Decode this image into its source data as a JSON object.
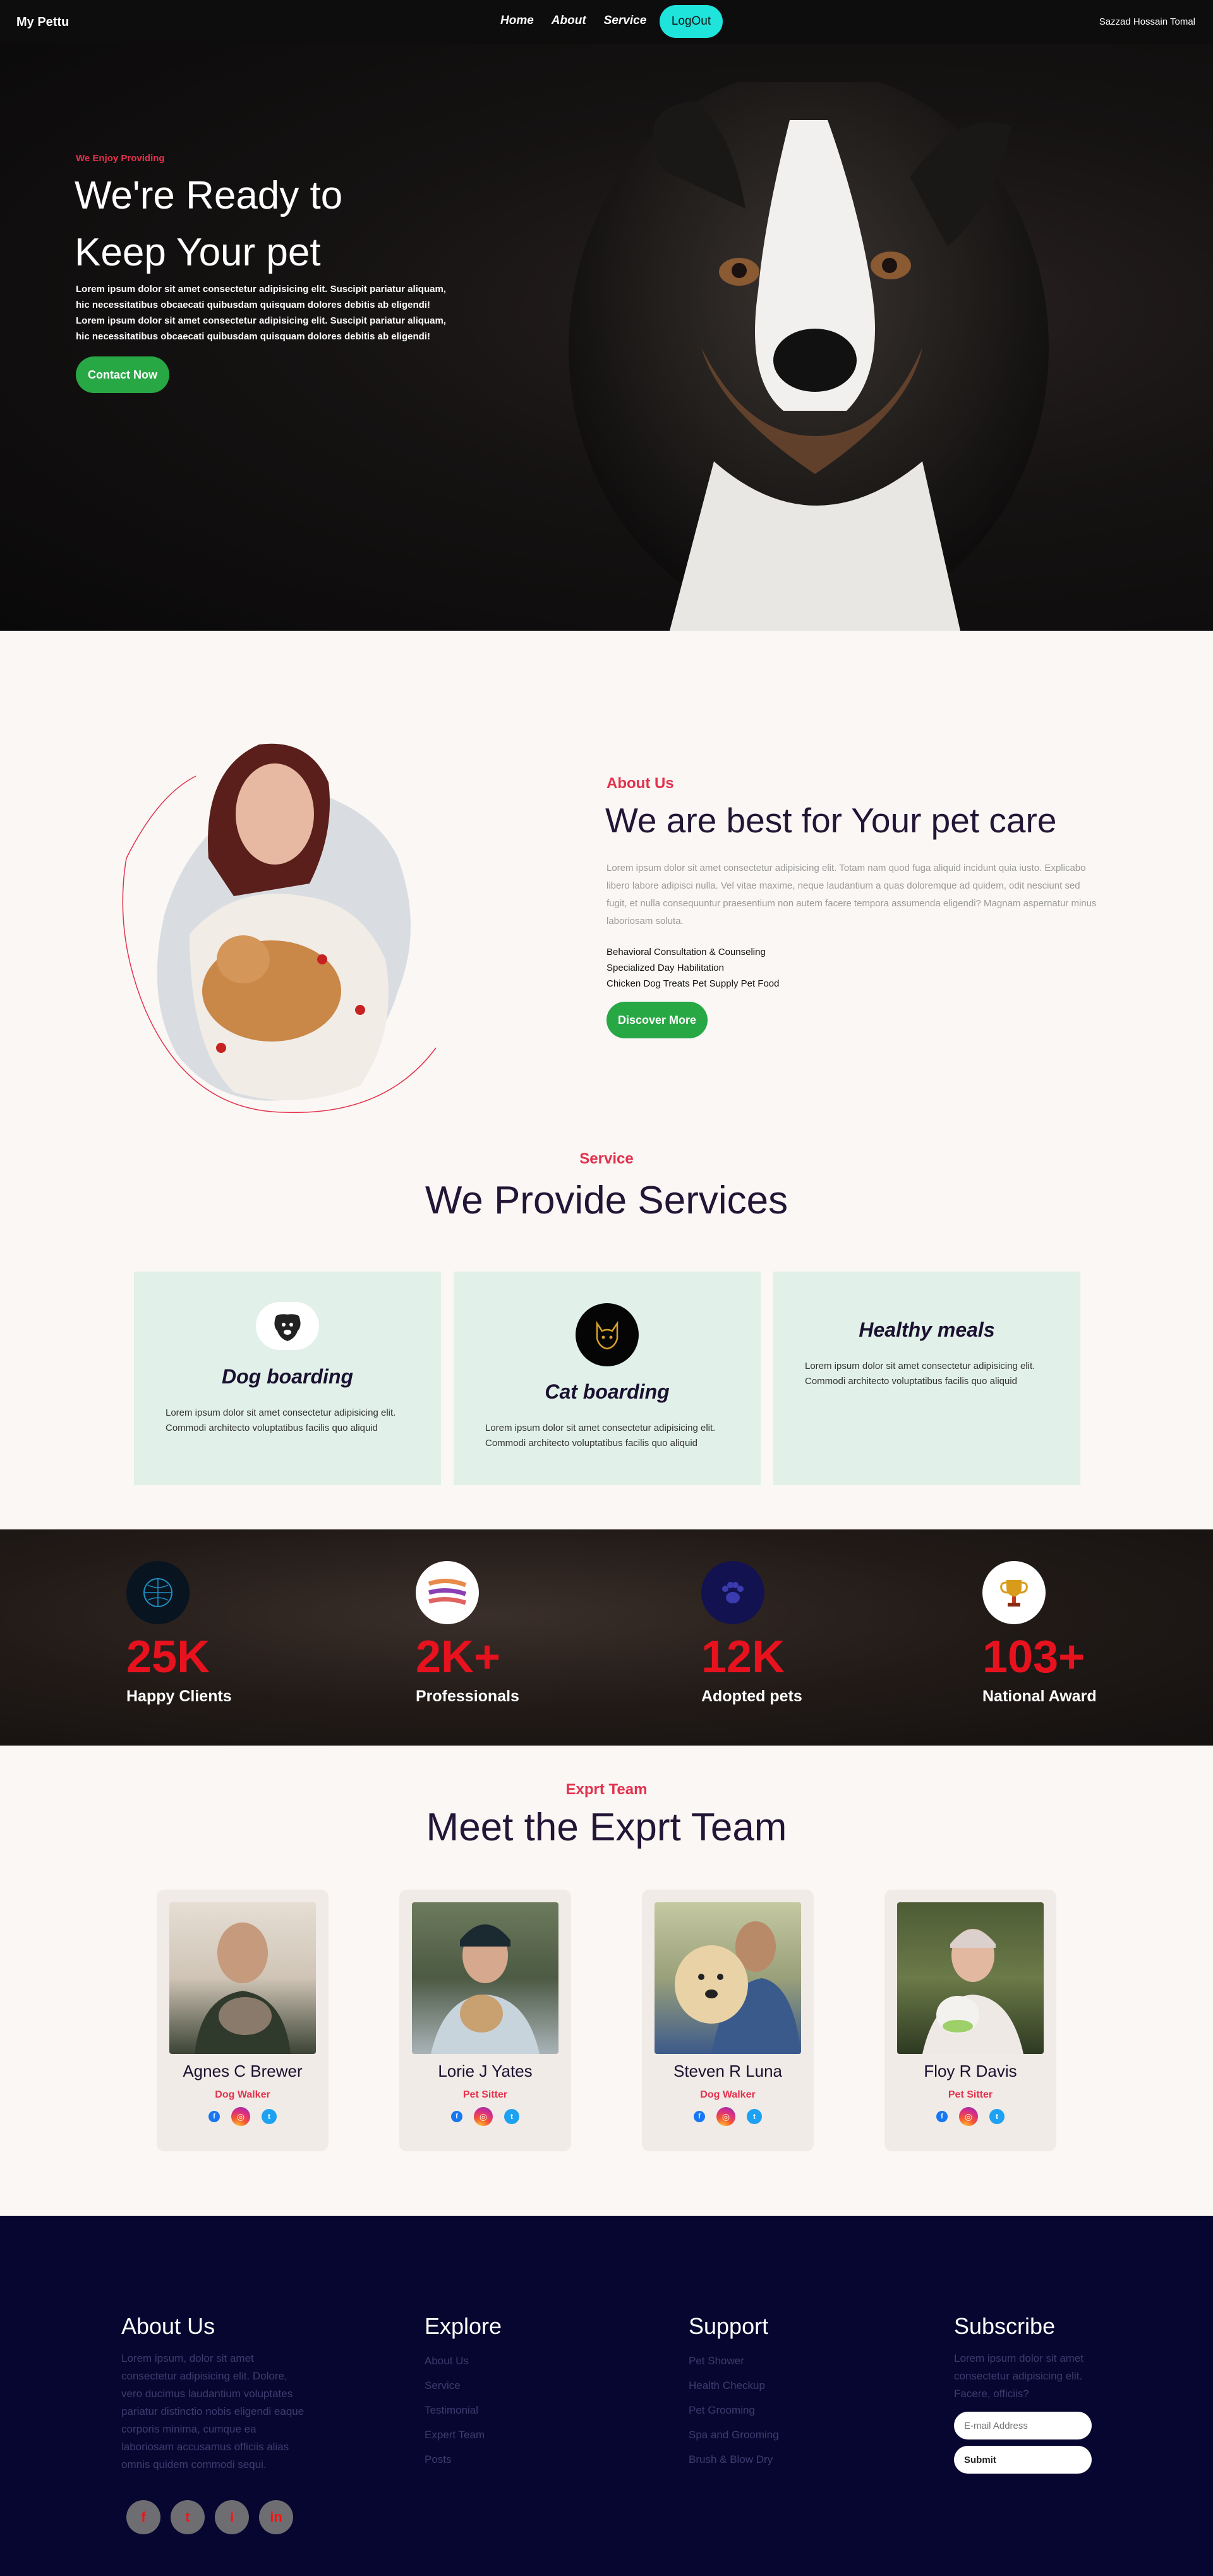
{
  "nav": {
    "brand": "My Pettu",
    "links": [
      "Home",
      "About",
      "Service"
    ],
    "logout": "LogOut",
    "user": "Sazzad Hossain Tomal"
  },
  "hero": {
    "eyebrow": "We Enjoy Providing",
    "title_line1": "We're Ready to",
    "title_line2": "Keep Your pet",
    "desc": "Lorem ipsum dolor sit amet consectetur adipisicing elit. Suscipit pariatur aliquam, hic necessitatibus obcaecati quibusdam quisquam dolores debitis ab eligendi! Lorem ipsum dolor sit amet consectetur adipisicing elit. Suscipit pariatur aliquam, hic necessitatibus obcaecati quibusdam quisquam dolores debitis ab eligendi!",
    "cta": "Contact Now"
  },
  "about": {
    "eyebrow": "About Us",
    "title": "We are best for Your pet care",
    "desc": "Lorem ipsum dolor sit amet consectetur adipisicing elit. Totam nam quod fuga aliquid incidunt quia iusto. Explicabo libero labore adipisci nulla. Vel vitae maxime, neque laudantium a quas doloremque ad quidem, odit nesciunt sed fugit, et nulla consequuntur praesentium non autem facere tempora assumenda eligendi? Magnam aspernatur minus laboriosam soluta.",
    "list": [
      "Behavioral Consultation & Counseling",
      "Specialized Day Habilitation",
      "Chicken Dog Treats Pet Supply Pet Food"
    ],
    "button": "Discover More"
  },
  "services": {
    "eyebrow": "Service",
    "title": "We Provide Services",
    "items": [
      {
        "title": "Dog boarding",
        "desc": "Lorem ipsum dolor sit amet consectetur adipisicing elit. Commodi architecto voluptatibus facilis quo aliquid",
        "icon": "dog-head-icon"
      },
      {
        "title": "Cat boarding",
        "desc": "Lorem ipsum dolor sit amet consectetur adipisicing elit. Commodi architecto voluptatibus facilis quo aliquid",
        "icon": "cat-head-icon"
      },
      {
        "title": "Healthy meals",
        "desc": "Lorem ipsum dolor sit amet consectetur adipisicing elit. Commodi architecto voluptatibus facilis quo aliquid",
        "icon": ""
      }
    ]
  },
  "stats": [
    {
      "value": "25K",
      "label": "Happy Clients",
      "icon": "globe-icon"
    },
    {
      "value": "2K+",
      "label": "Professionals",
      "icon": "brush-strokes-icon"
    },
    {
      "value": "12K",
      "label": "Adopted pets",
      "icon": "paw-icon"
    },
    {
      "value": "103+",
      "label": "National Award",
      "icon": "trophy-icon"
    }
  ],
  "team": {
    "eyebrow": "Exprt Team",
    "title": "Meet the Exprt Team",
    "members": [
      {
        "name": "Agnes C Brewer",
        "role": "Dog Walker"
      },
      {
        "name": "Lorie J Yates",
        "role": "Pet Sitter"
      },
      {
        "name": "Steven R Luna",
        "role": "Dog Walker"
      },
      {
        "name": "Floy R Davis",
        "role": "Pet Sitter"
      }
    ]
  },
  "footer": {
    "about": {
      "title": "About Us",
      "text": "Lorem ipsum, dolor sit amet consectetur adipisicing elit. Dolore, vero ducimus laudantium voluptates pariatur distinctio nobis eligendi eaque corporis minima, cumque ea laboriosam accusamus officiis alias omnis quidem commodi sequi."
    },
    "explore": {
      "title": "Explore",
      "links": [
        "About Us",
        "Service",
        "Testimonial",
        "Expert Team",
        "Posts"
      ]
    },
    "support": {
      "title": "Support",
      "links": [
        "Pet Shower",
        "Health Checkup",
        "Pet Grooming",
        "Spa and Grooming",
        "Brush & Blow Dry"
      ]
    },
    "subscribe": {
      "title": "Subscribe",
      "text": "Lorem ipsum dolor sit amet consectetur adipisicing elit. Facere, officiis?",
      "placeholder": "E-mail Address",
      "button": "Submit"
    },
    "socials": [
      "f",
      "t",
      "i",
      "in"
    ]
  },
  "colors": {
    "accent": "#e3314d",
    "green": "#28a745",
    "cyan": "#1fe4dc",
    "navy": "#070630"
  }
}
